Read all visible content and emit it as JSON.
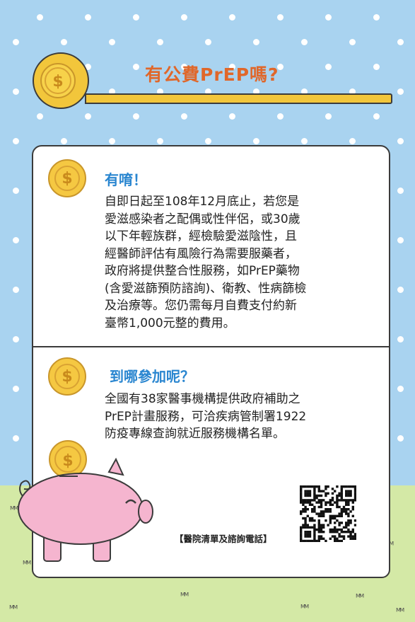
{
  "title": "有公費PrEP嗎?",
  "sections": [
    {
      "heading": "有唷！",
      "lines": [
        "自即日起至108年12月底止，若您是",
        "愛滋感染者之配偶或性伴侶，或30歲",
        "以下年輕族群，經檢驗愛滋陰性，且",
        "經醫師評估有風險行為需要服藥者，",
        "政府將提供整合性服務，如PrEP藥物",
        "(含愛滋篩預防諮詢)、衛教、性病篩檢",
        "及治療等。您仍需每月自費支付約新",
        "臺幣1,000元整的費用。"
      ]
    },
    {
      "heading": "到哪參加呢？",
      "lines": [
        "全國有38家醫事機構提供政府補助之",
        "PrEP計畫服務，可洽疾病管制署1922",
        "防疫專線查詢就近服務機構名單。"
      ]
    }
  ],
  "qr_label": "【醫院清單及諮詢電話】",
  "icons": [
    "dollar-coin-icon",
    "piggy-bank-icon",
    "qr-code-icon"
  ],
  "colors": {
    "sky": "#a9d3f0",
    "grass": "#d4e9a6",
    "title": "#e0672a",
    "heading": "#2a86d0",
    "coin": "#f2c63b",
    "pig": "#f5b5cf"
  }
}
